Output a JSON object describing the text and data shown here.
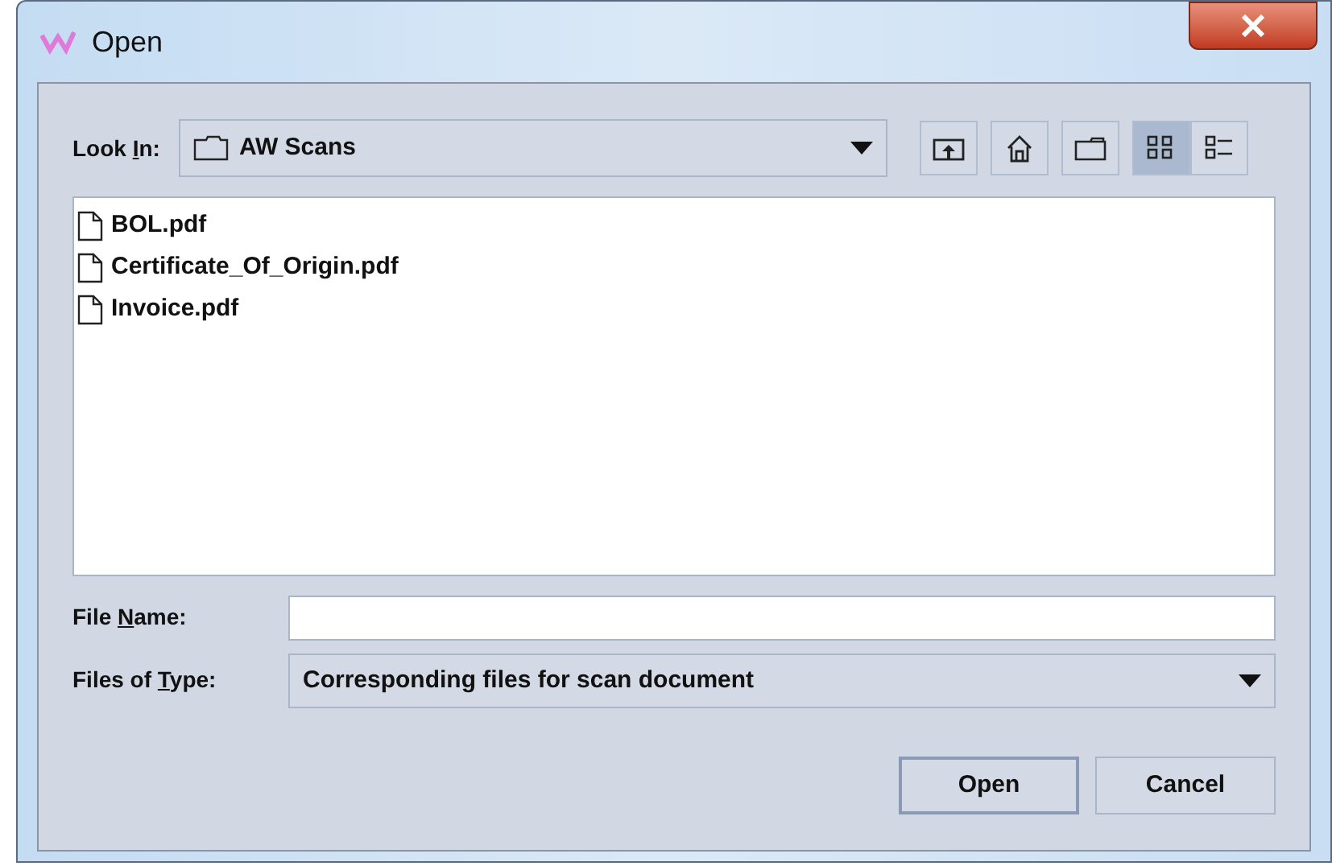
{
  "window": {
    "title": "Open"
  },
  "look_in": {
    "label": {
      "before": "Look ",
      "mnemonic": "I",
      "after": "n:"
    },
    "value": "AW Scans"
  },
  "toolbar": [
    {
      "kind": "up",
      "selected": false
    },
    {
      "kind": "home",
      "selected": false
    },
    {
      "kind": "new-folder",
      "selected": false
    },
    {
      "kind": "list",
      "selected": true
    },
    {
      "kind": "details",
      "selected": false
    }
  ],
  "files": [
    {
      "name": "BOL.pdf"
    },
    {
      "name": "Certificate_Of_Origin.pdf"
    },
    {
      "name": "Invoice.pdf"
    }
  ],
  "file_name": {
    "label": {
      "before": "File ",
      "mnemonic": "N",
      "after": "ame:"
    }
  },
  "files_of_type": {
    "label": {
      "before": "Files of ",
      "mnemonic": "T",
      "after": "ype:"
    },
    "value": "Corresponding files for scan document"
  },
  "buttons": [
    {
      "label": "Open",
      "kind": "default"
    },
    {
      "label": "Cancel",
      "kind": "normal"
    }
  ]
}
